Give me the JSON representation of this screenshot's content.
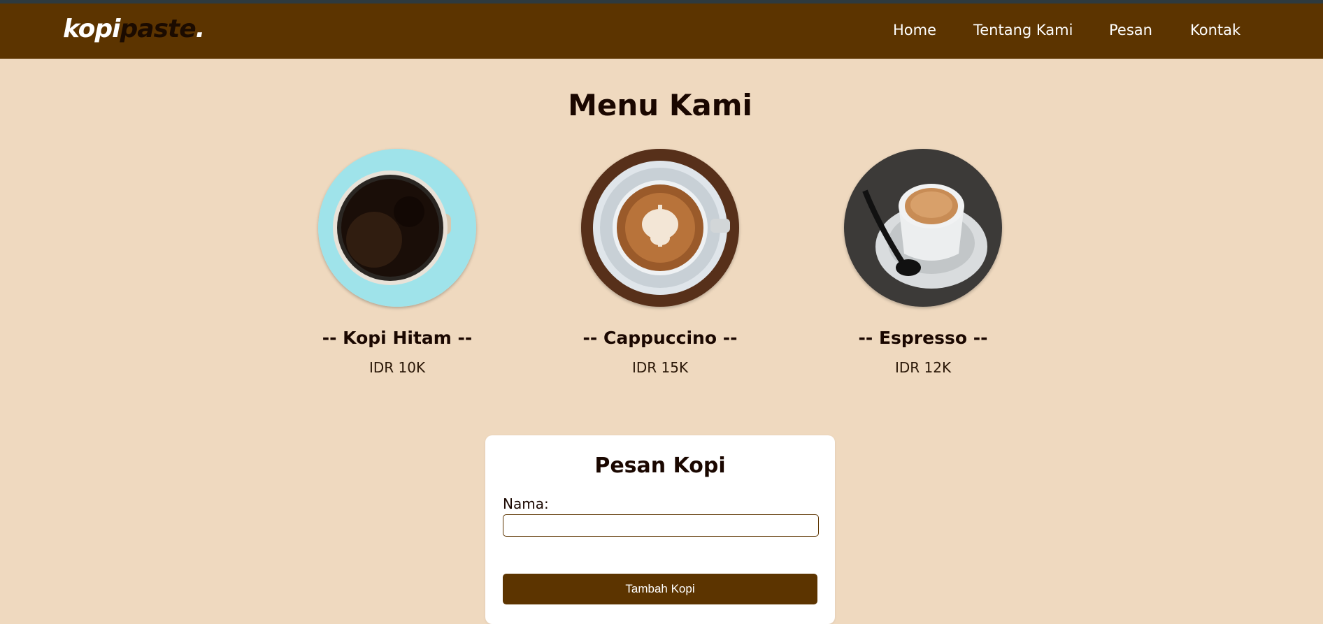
{
  "header": {
    "logo": {
      "part1": "kopi",
      "part2": "paste",
      "part3": "."
    },
    "nav": [
      "Home",
      "Tentang Kami",
      "Pesan",
      "Kontak"
    ]
  },
  "menu": {
    "title": "Menu Kami",
    "items": [
      {
        "name": "-- Kopi Hitam --",
        "price": "IDR 10K",
        "image": "black-coffee-cup"
      },
      {
        "name": "-- Cappuccino --",
        "price": "IDR 15K",
        "image": "cappuccino-latte-art"
      },
      {
        "name": "-- Espresso --",
        "price": "IDR 12K",
        "image": "espresso-cup-spoon"
      }
    ]
  },
  "order_form": {
    "title": "Pesan Kopi",
    "name_label": "Nama:",
    "name_value": "",
    "button_label": "Tambah Kopi"
  },
  "colors": {
    "header_bg": "#5c3400",
    "page_bg": "#efd9bf",
    "accent": "#5c3400"
  }
}
